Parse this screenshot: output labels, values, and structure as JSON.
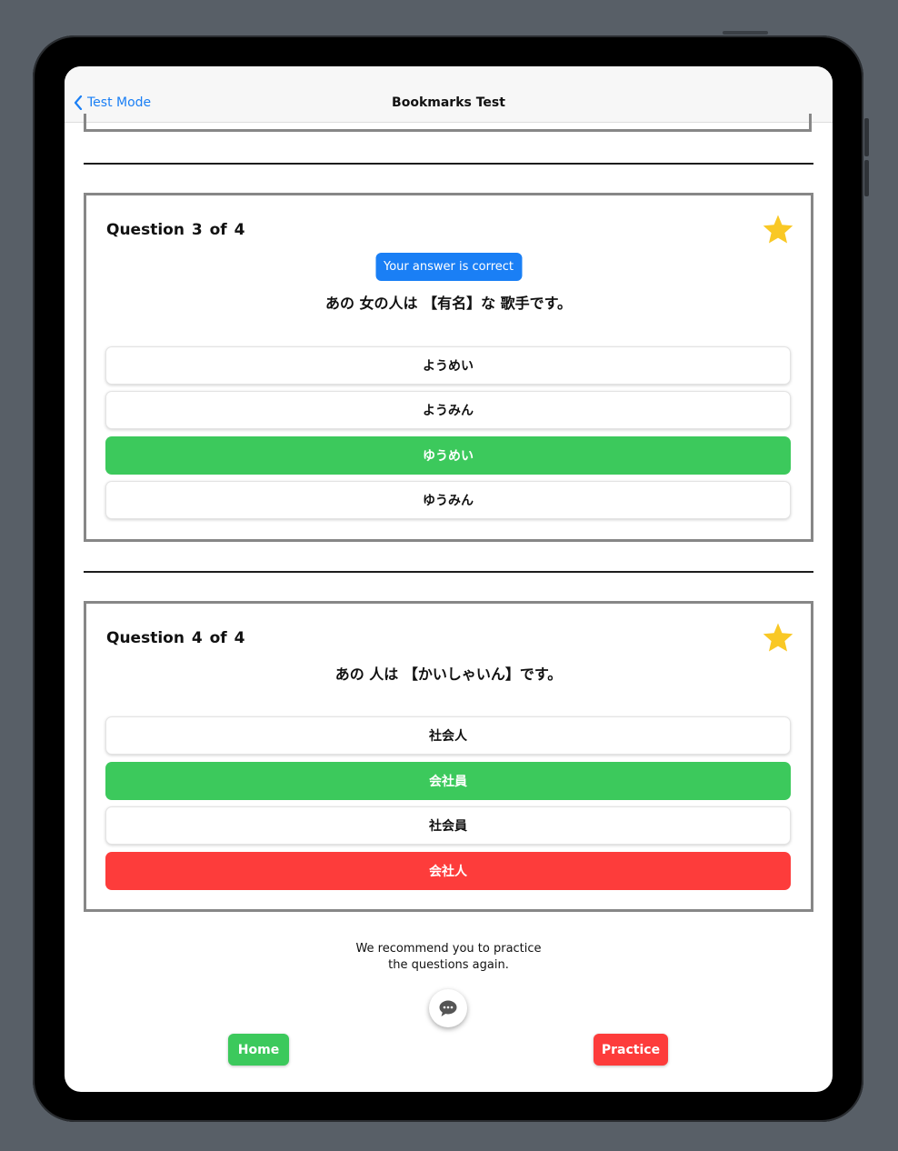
{
  "nav": {
    "back_label": "Test Mode",
    "title": "Bookmarks Test"
  },
  "questions": [
    {
      "title": "Question 3 of 4",
      "status_badge": "Your answer is correct",
      "text": "あの 女の人は 【有名】な 歌手です。",
      "bookmarked": true,
      "options": [
        {
          "label": "ようめい",
          "state": "neutral"
        },
        {
          "label": "ようみん",
          "state": "neutral"
        },
        {
          "label": "ゆうめい",
          "state": "correct"
        },
        {
          "label": "ゆうみん",
          "state": "neutral"
        }
      ]
    },
    {
      "title": "Question 4 of 4",
      "text": "あの 人は 【かいしゃいん】です。",
      "bookmarked": true,
      "options": [
        {
          "label": "社会人",
          "state": "neutral"
        },
        {
          "label": "会社員",
          "state": "correct"
        },
        {
          "label": "社会員",
          "state": "neutral"
        },
        {
          "label": "会社人",
          "state": "wrong"
        }
      ]
    }
  ],
  "footer": {
    "recommendation": "We recommend you to practice\nthe questions again.",
    "home_label": "Home",
    "practice_label": "Practice"
  },
  "colors": {
    "accent": "#1a7ff5",
    "correct": "#3cc95c",
    "wrong": "#fd3c3b",
    "star": "#f9c825"
  }
}
